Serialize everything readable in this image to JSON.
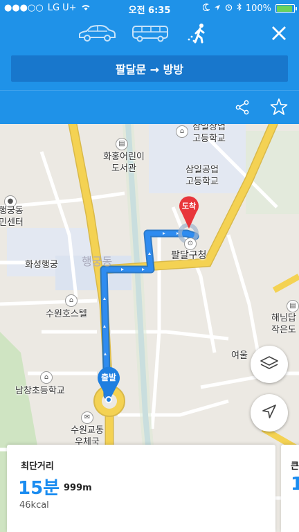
{
  "status_bar": {
    "signal": "●●●○○",
    "carrier": "LG U+",
    "time": "오전 6:35",
    "battery_percent": "100%",
    "battery_level": 1.0
  },
  "modes": [
    {
      "name": "car",
      "icon": "car-icon",
      "selected": false
    },
    {
      "name": "bus",
      "icon": "bus-icon",
      "selected": false
    },
    {
      "name": "walk",
      "icon": "walk-icon",
      "selected": true
    }
  ],
  "route": {
    "label": "팔달문 → 방방",
    "close_icon": "close-icon",
    "share_icon": "share-icon",
    "star_icon": "star-icon"
  },
  "map": {
    "labels": {
      "school_top": "삼일상업\n고등학교",
      "school_top2": "삼일공업\n고등학교",
      "library": "화홍어린이\n도서관",
      "community": "행궁동\n민센터",
      "palace": "화성행궁",
      "palace_ghost": "행궁동",
      "hostel": "수원호스텔",
      "gu_office": "팔달구청",
      "elementary": "남창초등학교",
      "post_office": "수원교동\n우체국",
      "haenim": "해님답\n작은도",
      "yeoul": "여울",
      "arrival": "도착",
      "departure": "출발"
    },
    "colors": {
      "route": "#2f8cf0",
      "arrival_pin": "#e8363b",
      "road_yellow": "#f4d253",
      "accent": "#1f92e8"
    },
    "buttons": {
      "layers_icon": "layers-icon",
      "locate_icon": "navigation-arrow-icon"
    }
  },
  "cards": [
    {
      "title": "최단거리",
      "time": "15분",
      "distance": "999m",
      "calories": "46kcal"
    },
    {
      "title": "큰",
      "time": "1"
    }
  ]
}
